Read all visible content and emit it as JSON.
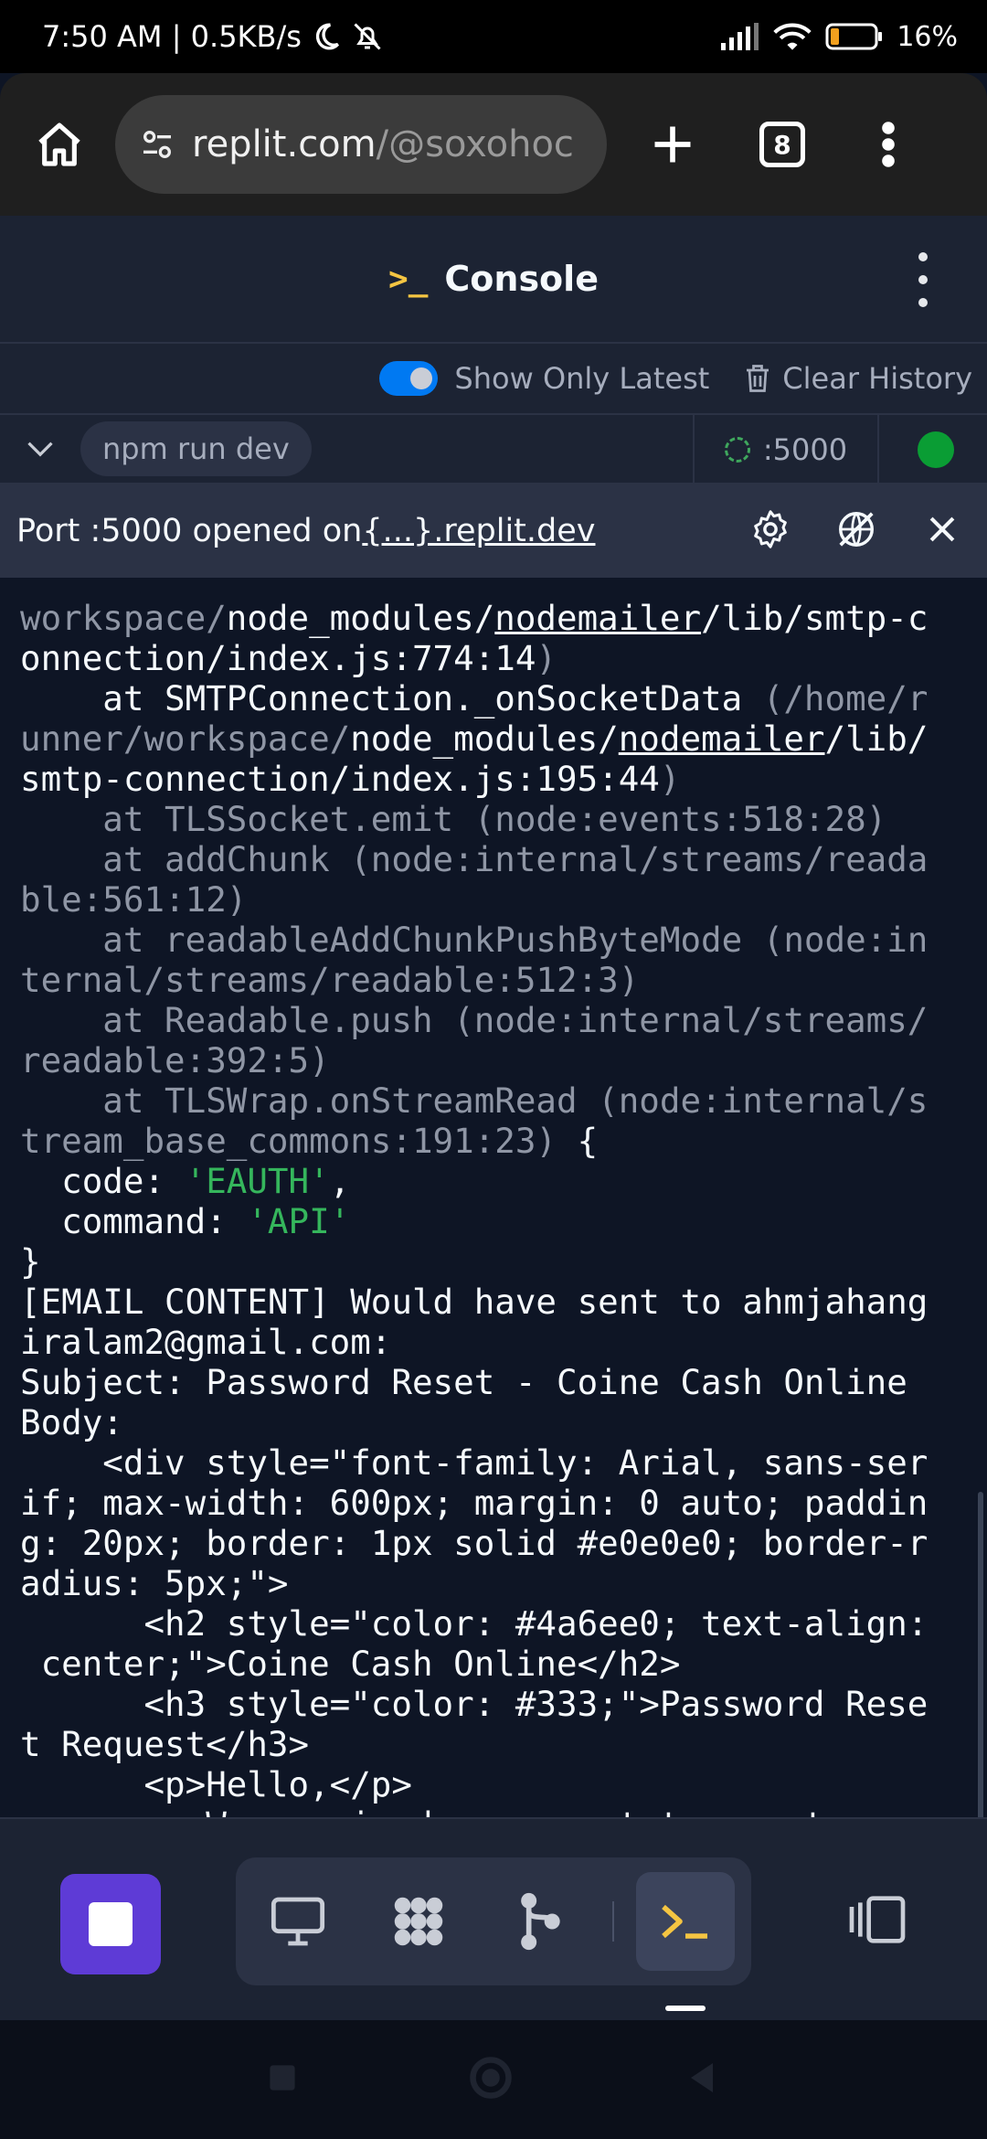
{
  "status_bar": {
    "time_speed": "7:50 AM | 0.5KB/s",
    "battery": "16%",
    "icons": [
      "moon-icon",
      "bell-off-icon",
      "signal-icon",
      "wifi-icon",
      "battery-icon"
    ]
  },
  "browser": {
    "url_host": "replit.com",
    "url_path": "/@soxohoc",
    "tab_count": "8",
    "icons": [
      "home-icon",
      "tune-icon",
      "plus-icon",
      "more-vertical-icon"
    ]
  },
  "console_header": {
    "prompt": ">_",
    "title": "Console"
  },
  "options": {
    "show_only_latest": "Show Only Latest",
    "show_only_latest_on": true,
    "clear_history": "Clear History"
  },
  "process": {
    "command": "npm run dev",
    "port": ":5000",
    "status_color": "#0a9d34"
  },
  "port_banner": {
    "text": "Port :5000 opened on ",
    "link": "{...}.replit.dev"
  },
  "output": {
    "l1a": "workspace/",
    "l1b": "node_modules/",
    "l1c": "nodemailer",
    "l1d": "/lib/smtp-c",
    "l2a": "onnection/index.js:774:14",
    "l2b": ")",
    "l3a": "    at SMTPConnection._onSocketData ",
    "l3b": "(/home/r",
    "l4a": "unner/workspace/",
    "l4b": "node_modules/",
    "l4c": "nodemailer",
    "l4d": "/lib/",
    "l5a": "smtp-connection/index.js:195:44",
    "l5b": ")",
    "l6": "    at TLSSocket.emit (node:events:518:28)",
    "l7": "    at addChunk (node:internal/streams/reada",
    "l8": "ble:561:12)",
    "l9": "    at readableAddChunkPushByteMode (node:in",
    "l10": "ternal/streams/readable:512:3)",
    "l11": "    at Readable.push (node:internal/streams/",
    "l12": "readable:392:5)",
    "l13": "    at TLSWrap.onStreamRead (node:internal/s",
    "l14a": "tream_base_commons:191:23)",
    "l14b": " {",
    "l15a": "  code: ",
    "l15b": "'EAUTH'",
    "l15c": ",",
    "l16a": "  command: ",
    "l16b": "'API'",
    "l17": "}",
    "l18": "[EMAIL CONTENT] Would have sent to ahmjahang",
    "l19": "iralam2@gmail.com:",
    "l20": "Subject: Password Reset - Coine Cash Online",
    "l21": "Body:",
    "l22": "    <div style=\"font-family: Arial, sans-ser",
    "l23": "if; max-width: 600px; margin: 0 auto; paddin",
    "l24": "g: 20px; border: 1px solid #e0e0e0; border-r",
    "l25": "adius: 5px;\">",
    "l26": "      <h2 style=\"color: #4a6ee0; text-align:",
    "l27": " center;\">Coine Cash Online</h2>",
    "l28": "      <h3 style=\"color: #333;\">Password Rese",
    "l29": "t Request</h3>",
    "l30": "      <p>Hello,</p>",
    "l31": "      <p>We received a request to reset your"
  },
  "toolbar": {
    "icons": [
      "stop-icon",
      "monitor-icon",
      "grid-blob-icon",
      "git-branch-icon",
      "terminal-icon",
      "panel-icon"
    ],
    "active": "terminal-icon",
    "run_color": "#5e3bd6"
  }
}
